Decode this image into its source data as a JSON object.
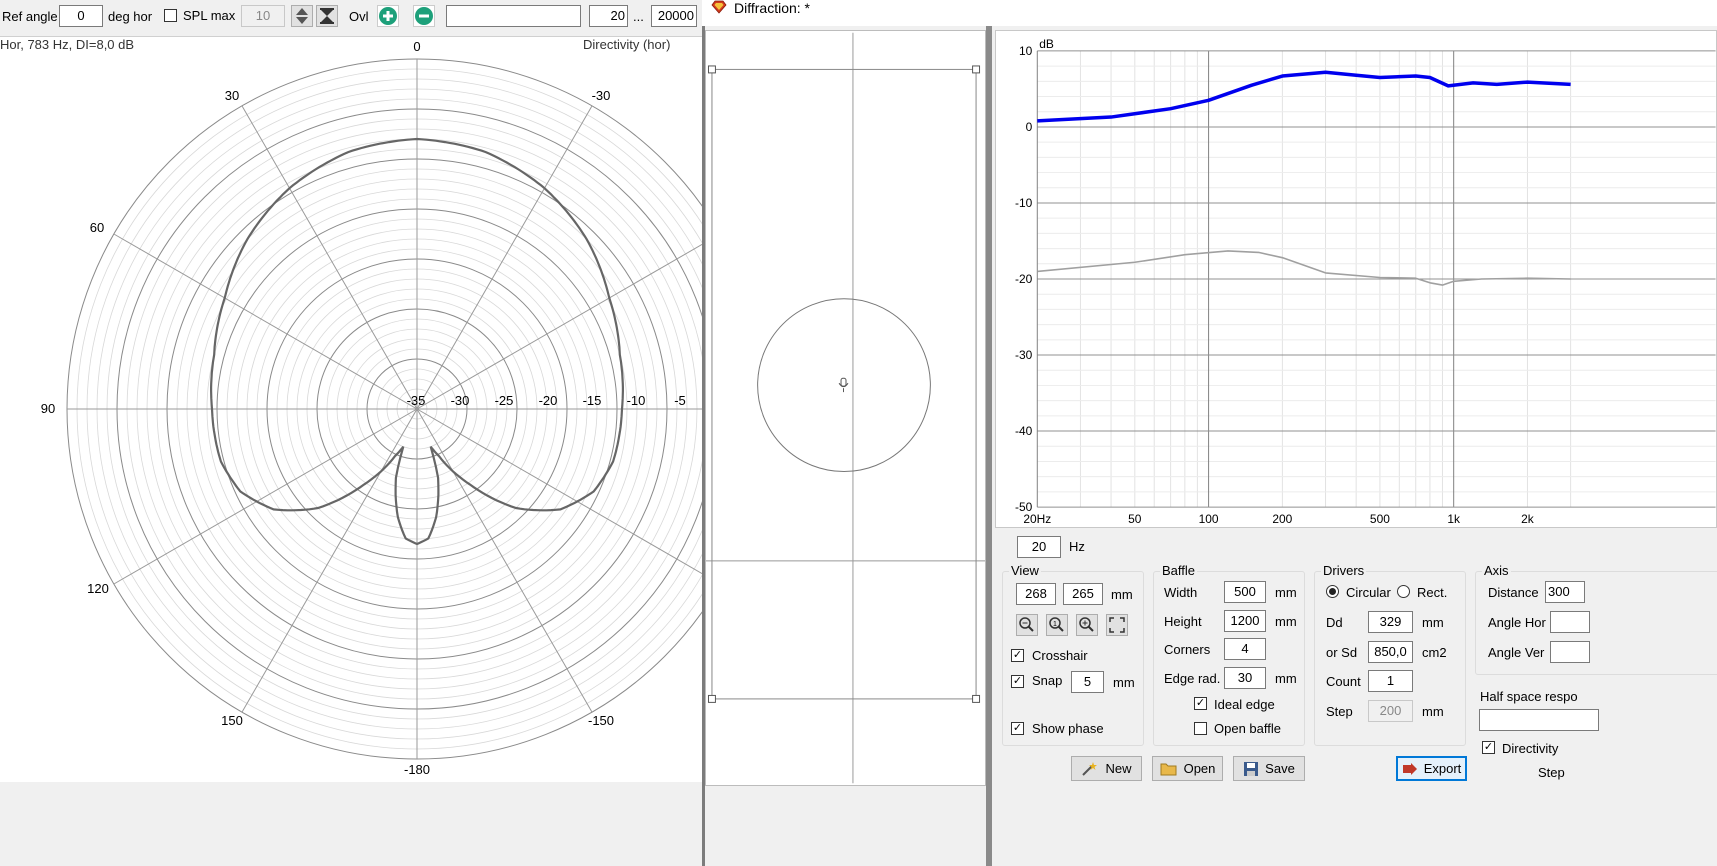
{
  "toolbar": {
    "ref_angle_label": "Ref angle",
    "ref_angle_value": "0",
    "deg_hor_label": "deg hor",
    "spl_max_label": "SPL max",
    "spl_max_value": "10",
    "ovl_label": "Ovl",
    "freq_from": "20",
    "range_sep": "...",
    "freq_to": "20000"
  },
  "polar": {
    "info": "Hor, 783 Hz, DI=8,0 dB",
    "title": "Directivity (hor)",
    "angle_labels": {
      "a0": "0",
      "a30": "30",
      "am30": "-30",
      "a60": "60",
      "a90": "90",
      "a120": "120",
      "a150": "150",
      "am150": "-150",
      "a180": "-180"
    },
    "ring_labels": [
      "-35",
      "-30",
      "-25",
      "-20",
      "-15",
      "-10",
      "-5"
    ]
  },
  "diffraction_window": {
    "title": "Diffraction: *"
  },
  "fr_chart": {
    "chart_data": {
      "type": "line",
      "title": "",
      "xlabel": "",
      "ylabel": "dB",
      "xscale": "log",
      "xlim": [
        20,
        3200
      ],
      "ylim": [
        -50,
        10
      ],
      "x_tick_labels": [
        "20Hz",
        "50",
        "100",
        "200",
        "500",
        "1k",
        "2k"
      ],
      "y_tick_labels": [
        "10",
        "0",
        "-10",
        "-20",
        "-30",
        "-40",
        "-50"
      ],
      "series": [
        {
          "color": "#0000ee",
          "x": [
            20,
            40,
            70,
            100,
            150,
            200,
            300,
            400,
            500,
            700,
            800,
            950,
            1200,
            1500,
            2000,
            3000
          ],
          "y": [
            0.8,
            1.3,
            2.4,
            3.5,
            5.5,
            6.7,
            7.2,
            6.8,
            6.5,
            6.7,
            6.5,
            5.4,
            5.8,
            5.6,
            5.9,
            5.6
          ]
        },
        {
          "color": "#a0a0a0",
          "x": [
            20,
            50,
            80,
            120,
            160,
            200,
            300,
            500,
            700,
            800,
            900,
            1000,
            1300,
            2000,
            3000
          ],
          "y": [
            -19.0,
            -17.8,
            -16.8,
            -16.3,
            -16.5,
            -17.2,
            -19.2,
            -19.8,
            -19.9,
            -20.5,
            -20.8,
            -20.3,
            -20.0,
            -19.9,
            -20.0
          ]
        }
      ]
    }
  },
  "freq_input": {
    "value": "20",
    "unit": "Hz"
  },
  "view": {
    "title": "View",
    "x": "268",
    "y": "265",
    "unit": "mm",
    "crosshair": "Crosshair",
    "snap": "Snap",
    "snap_value": "5",
    "snap_unit": "mm",
    "show_phase": "Show phase"
  },
  "baffle": {
    "title": "Baffle",
    "width_label": "Width",
    "width": "500",
    "width_unit": "mm",
    "height_label": "Height",
    "height": "1200",
    "height_unit": "mm",
    "corners_label": "Corners",
    "corners": "4",
    "edge_label": "Edge rad.",
    "edge": "30",
    "edge_unit": "mm",
    "ideal_edge": "Ideal edge",
    "open_baffle": "Open baffle"
  },
  "drivers": {
    "title": "Drivers",
    "circular": "Circular",
    "rect": "Rect.",
    "dd_label": "Dd",
    "dd": "329",
    "dd_unit": "mm",
    "sd_label": "or Sd",
    "sd": "850,0",
    "sd_unit": "cm2",
    "count_label": "Count",
    "count": "1",
    "step_label": "Step",
    "step": "200",
    "step_unit": "mm"
  },
  "axis": {
    "title": "Axis",
    "distance_label": "Distance",
    "distance": "300",
    "angle_hor_label": "Angle Hor",
    "angle_ver_label": "Angle Ver",
    "half_space": "Half space respo",
    "directivity": "Directivity",
    "step_label": "Step"
  },
  "buttons": {
    "new": "New",
    "open": "Open",
    "save": "Save",
    "export": "Export"
  }
}
